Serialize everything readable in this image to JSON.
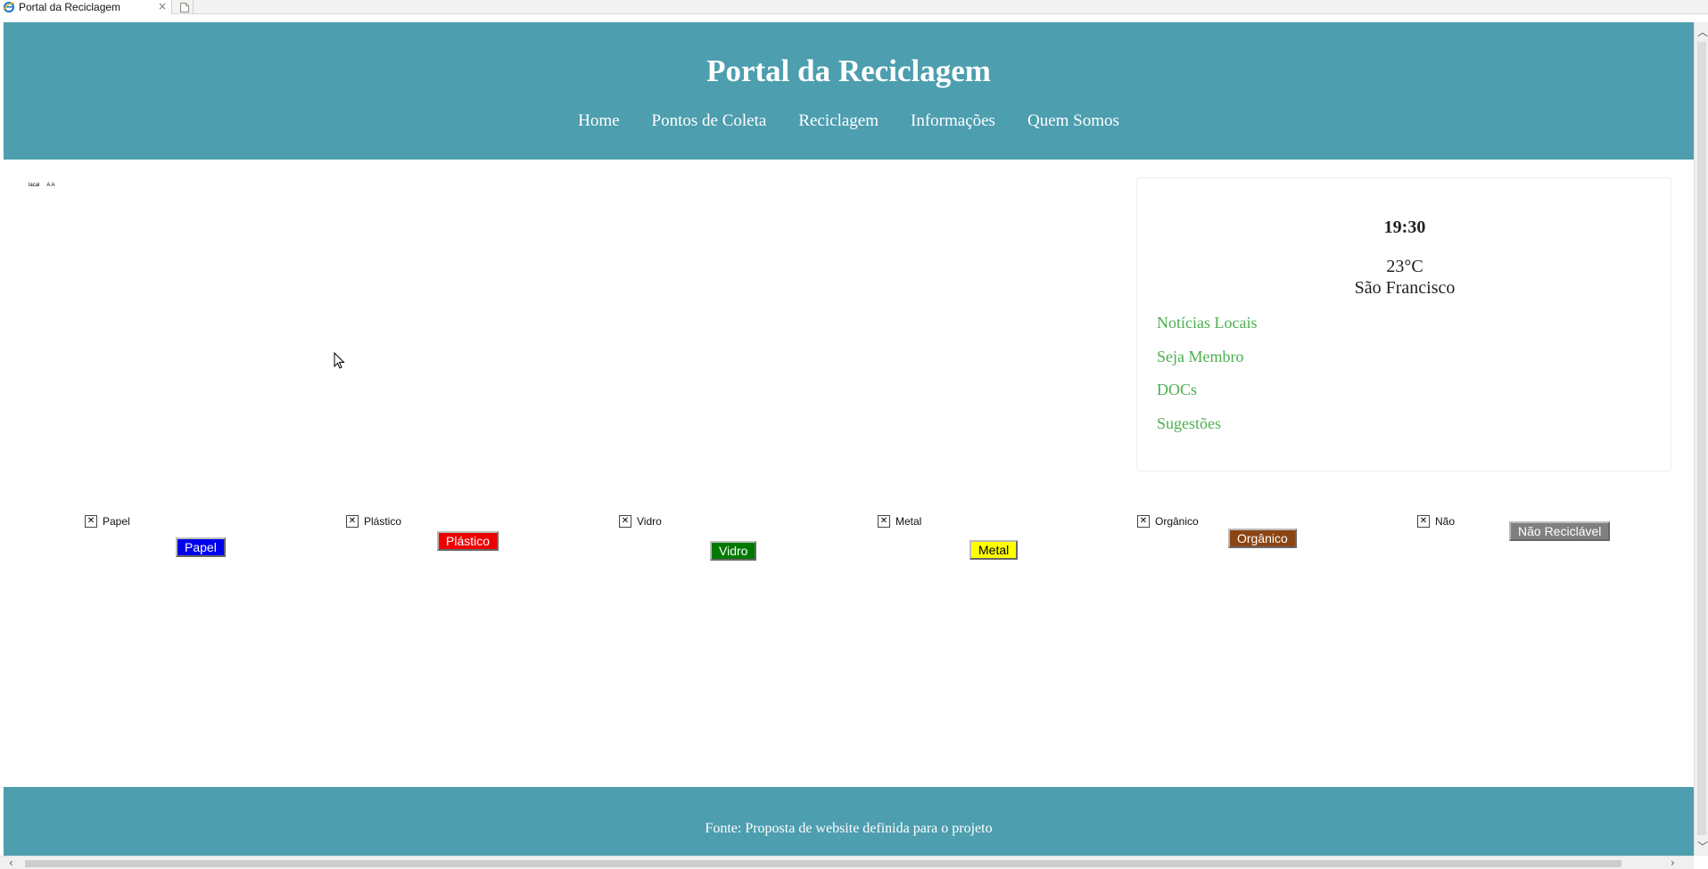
{
  "browser": {
    "tab_title": "Portal da Reciclagem",
    "tab_close": "×"
  },
  "header": {
    "title": "Portal da Reciclagem",
    "nav": [
      "Home",
      "Pontos de Coleta",
      "Reciclagem",
      "Informações",
      "Quem Somos"
    ]
  },
  "map_placeholder": {
    "text_a": "lacal",
    "text_b": "A A"
  },
  "sidebar": {
    "time": "19:30",
    "temperature": "23°C",
    "city": "São Francisco",
    "links": [
      "Notícias Locais",
      "Seja Membro",
      "DOCs",
      "Sugestões"
    ]
  },
  "categories": [
    {
      "label": "Papel",
      "button": "Papel",
      "color": "#0000ee"
    },
    {
      "label": "Plástico",
      "button": "Plástico",
      "color": "#ee0000"
    },
    {
      "label": "Vidro",
      "button": "Vidro",
      "color": "#007a00"
    },
    {
      "label": "Metal",
      "button": "Metal",
      "color": "#ffff00"
    },
    {
      "label": "Orgânico",
      "button": "Orgânico",
      "color": "#8b4513"
    },
    {
      "label": "Não",
      "button": "Não Reciclável",
      "color": "#808080"
    }
  ],
  "footer": {
    "text": "Fonte: Proposta de website definida para o projeto"
  },
  "colors": {
    "header_bg": "#4d9eaf",
    "sidebar_link": "#4caf50"
  },
  "icons": {
    "broken_image": "broken-image-icon",
    "favicon": "ie-icon",
    "new_tab": "new-tab-icon"
  }
}
